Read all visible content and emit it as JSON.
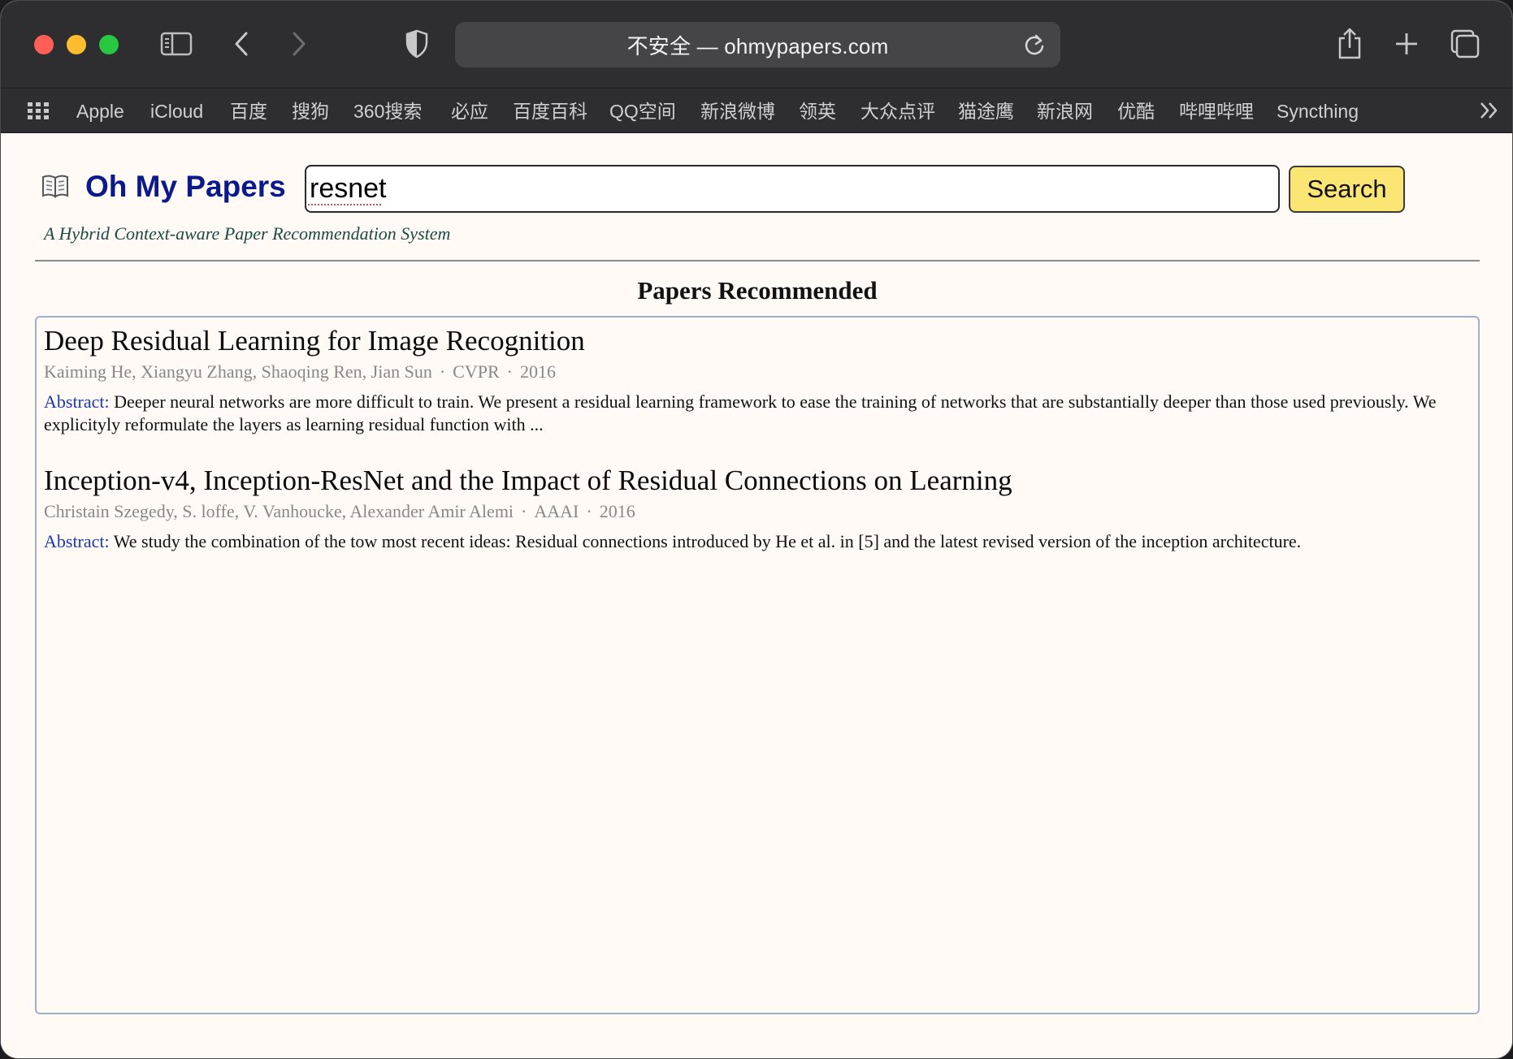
{
  "browser": {
    "address": "不安全 — ohmypapers.com",
    "bookmarks": [
      "Apple",
      "iCloud",
      "百度",
      "搜狗",
      "360搜索",
      "必应",
      "百度百科",
      "QQ空间",
      "新浪微博",
      "领英",
      "大众点评",
      "猫途鹰",
      "新浪网",
      "优酷",
      "哔哩哔哩",
      "Syncthing"
    ]
  },
  "site": {
    "title": "Oh My Papers",
    "tagline": "A Hybrid Context-aware Paper Recommendation System",
    "search_value": "resnet",
    "search_button": "Search",
    "section_title": "Papers Recommended"
  },
  "papers": [
    {
      "title": "Deep Residual Learning for Image Recognition",
      "authors": "Kaiming He, Xiangyu Zhang, Shaoqing Ren, Jian Sun",
      "venue": "CVPR",
      "year": "2016",
      "abstract_label": "Abstract:",
      "abstract": "Deeper neural networks are more difficult to train. We present a residual learning framework to ease the training of networks that are substantially deeper than those used previously. We explicityly reformulate the layers as learning residual function with ..."
    },
    {
      "title": "Inception-v4, Inception-ResNet and the Impact of Residual Connections on Learning",
      "authors": "Christain Szegedy, S. loffe, V. Vanhoucke, Alexander Amir Alemi",
      "venue": "AAAI",
      "year": "2016",
      "abstract_label": "Abstract:",
      "abstract": "We study the combination of the tow most recent ideas: Residual connections introduced by He et al. in [5] and the latest revised version of the inception architecture."
    }
  ],
  "separator": "·",
  "icons": {
    "sidebar": "sidebar-icon",
    "back": "chevron-left-icon",
    "forward": "chevron-right-icon",
    "privacy": "shield-icon",
    "reload": "reload-icon",
    "share": "share-icon",
    "new_tab": "plus-icon",
    "tabs": "tabs-overview-icon",
    "logo": "book-icon"
  },
  "colors": {
    "brand_title": "#0a1a8c",
    "search_button": "#fbe573",
    "abstract_label": "#1a38b8",
    "page_background": "#fffaf5"
  }
}
